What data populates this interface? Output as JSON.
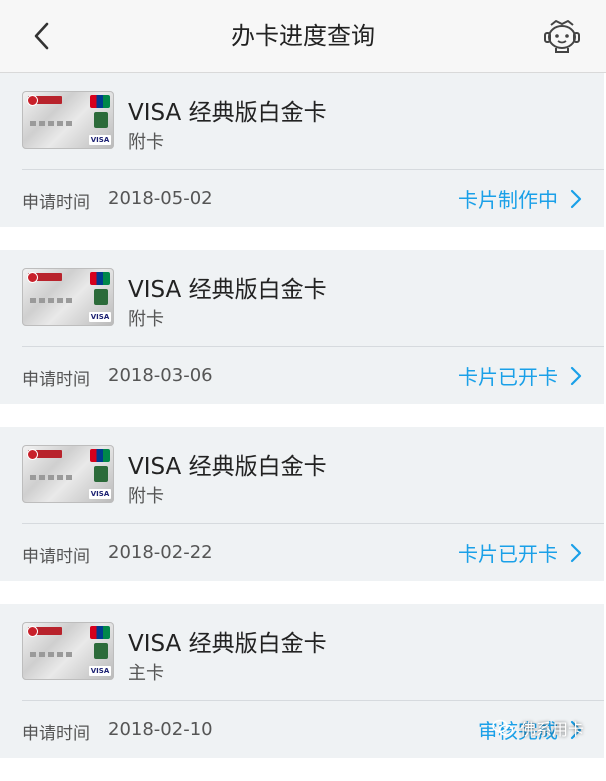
{
  "header": {
    "title": "办卡进度查询",
    "back_icon": "chevron-left-icon",
    "service_icon": "robot-service-icon"
  },
  "colors": {
    "accent": "#1aa0e8",
    "card_bg": "#eff2f4",
    "divider": "#d6dade"
  },
  "applications": [
    {
      "card_name": "VISA 经典版白金卡",
      "card_type": "附卡",
      "apply_label": "申请时间",
      "apply_date": "2018-05-02",
      "status": "卡片制作中"
    },
    {
      "card_name": "VISA 经典版白金卡",
      "card_type": "附卡",
      "apply_label": "申请时间",
      "apply_date": "2018-03-06",
      "status": "卡片已开卡"
    },
    {
      "card_name": "VISA 经典版白金卡",
      "card_type": "附卡",
      "apply_label": "申请时间",
      "apply_date": "2018-02-22",
      "status": "卡片已开卡"
    },
    {
      "card_name": "VISA 经典版白金卡",
      "card_type": "主卡",
      "apply_label": "申请时间",
      "apply_date": "2018-02-10",
      "status": "审核完成"
    }
  ],
  "card_image": {
    "brand_text": "VISA"
  },
  "watermark": {
    "text": "佛系用卡"
  }
}
